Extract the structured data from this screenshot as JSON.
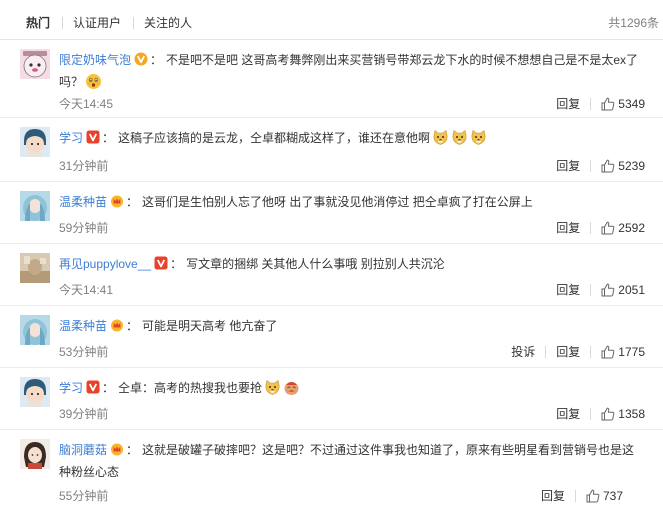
{
  "tabs": {
    "hot": "热门",
    "verified": "认证用户",
    "following": "关注的人"
  },
  "total": "共1296条",
  "actions": {
    "reply": "回复",
    "report": "投诉"
  },
  "colors": {
    "accent_orange": "#eb7350",
    "link_blue": "#3c7ed3",
    "badge_yellow": "#f5a623",
    "badge_red": "#e8422a"
  },
  "comments": [
    {
      "user": "限定奶味气泡",
      "badge": "yellow-v-icon",
      "text": "不是吧不是吧 这哥高考舞弊刚出来买营销号带郑云龙下水的时候不想想自己是不是太ex了吗？",
      "emoji": [
        "surprised-emoji"
      ],
      "time": "今天14:45",
      "likes": "5349"
    },
    {
      "user": "学习",
      "badge": "red-v-icon",
      "text": "这稿子应该搞的是云龙，仝卓都糊成这样了，谁还在意他啊",
      "emoji": [
        "doge-emoji",
        "doge-emoji",
        "doge-emoji"
      ],
      "time": "31分钟前",
      "likes": "5239"
    },
    {
      "user": "温柔种苗",
      "badge": "crown-icon",
      "text": "这哥们是生怕别人忘了他呀 出了事就没见他消停过 把仝卓疯了打在公屏上",
      "emoji": [],
      "time": "59分钟前",
      "likes": "2592"
    },
    {
      "user": "再见puppylove__",
      "badge": "red-v-icon",
      "text": "写文章的捆绑 关其他人什么事哦 别拉别人共沉沦",
      "emoji": [],
      "time": "今天14:41",
      "likes": "2051"
    },
    {
      "user": "温柔种苗",
      "badge": "crown-icon",
      "text": "可能是明天高考 他亢奋了",
      "emoji": [],
      "time": "53分钟前",
      "likes": "1775",
      "report": true
    },
    {
      "user": "学习",
      "badge": "red-v-icon",
      "text": "仝卓：高考的热搜我也要抢",
      "emoji": [
        "doge-emoji",
        "crying-emoji"
      ],
      "time": "39分钟前",
      "likes": "1358"
    },
    {
      "user": "脑洞蘑菇",
      "badge": "crown-icon",
      "text": "这就是破罐子破摔吧？这是吧？不过通过这件事我也知道了，原来有些明星看到营销号也是这种粉丝心态",
      "emoji": [],
      "time": "55分钟前",
      "likes": "737"
    }
  ]
}
